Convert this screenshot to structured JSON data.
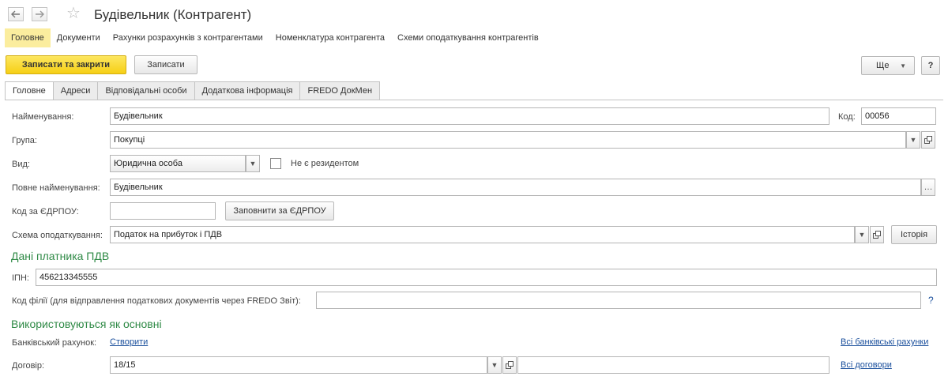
{
  "window": {
    "title": "Будівельник (Контрагент)"
  },
  "topnav": [
    {
      "label": "Головне",
      "active": true
    },
    {
      "label": "Документи"
    },
    {
      "label": "Рахунки розрахунків з контрагентами"
    },
    {
      "label": "Номенклатура контрагента"
    },
    {
      "label": "Схеми оподаткування контрагентів"
    }
  ],
  "toolbar": {
    "save_close": "Записати та закрити",
    "save": "Записати",
    "more": "Ще",
    "help": "?"
  },
  "tabs": [
    {
      "label": "Головне",
      "active": true
    },
    {
      "label": "Адреси"
    },
    {
      "label": "Відповідальні особи"
    },
    {
      "label": "Додаткова інформація"
    },
    {
      "label": "FREDO ДокМен"
    }
  ],
  "form": {
    "name_label": "Найменування:",
    "name_value": "Будівельник",
    "code_label": "Код:",
    "code_value": "00056",
    "group_label": "Група:",
    "group_value": "Покупці",
    "kind_label": "Вид:",
    "kind_value": "Юридична особа",
    "nonresident_label": "Не є резидентом",
    "full_name_label": "Повне найменування:",
    "full_name_value": "Будівельник",
    "edrpou_label": "Код за ЄДРПОУ:",
    "edrpou_value": "",
    "fill_edrpou_button": "Заповнити за ЄДРПОУ",
    "tax_scheme_label": "Схема оподаткування:",
    "tax_scheme_value": "Податок на прибуток і ПДВ",
    "history_button": "Історія",
    "vat_section_title": "Дані платника ПДВ",
    "ipn_label": "ІПН:",
    "ipn_value": "456213345555",
    "branch_code_label": "Код філії (для відправлення податкових документів через FREDO Звіт):",
    "branch_code_value": "",
    "branch_help": "?",
    "main_section_title": "Використовуються як основні",
    "bank_account_label": "Банківський рахунок:",
    "bank_account_link": "Створити",
    "all_bank_accounts_link": "Всі банківські рахунки",
    "contract_label": "Договір:",
    "contract_value": "18/15",
    "contract_extra_value": "",
    "all_contracts_link": "Всі договори"
  }
}
